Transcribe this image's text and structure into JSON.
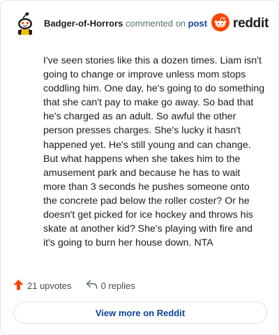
{
  "header": {
    "username": "Badger-of-Horrors",
    "action_text": "commented on",
    "post_link": "post",
    "brand_name": "reddit"
  },
  "comment": {
    "body": "I've seen stories like this a dozen times. Liam isn't going to change or improve unless mom stops coddling him. One day, he's going to do something that she can't pay to make go away. So bad that he's charged as an adult. So awful the other person presses charges. She's lucky it hasn't happened yet. He's still young and can change. But what happens when she takes him to the amusement park and because he has to wait more than 3 seconds he pushes someone onto the concrete pad below the roller coster? Or he doesn't get picked for ice hockey and throws his skate at another kid? She's playing with fire and it's going to burn her house down. NTA"
  },
  "actions": {
    "upvotes": "21 upvotes",
    "replies": "0 replies"
  },
  "view_more_label": "View more on Reddit",
  "icons": {
    "avatar": "snoo-avatar-icon",
    "brand": "reddit-logo-icon",
    "upvote": "upvote-arrow-icon",
    "reply": "reply-icon"
  },
  "colors": {
    "brand_orange": "#ff4500",
    "link_blue": "#0a449b",
    "upvote_orange": "#ff4500"
  }
}
